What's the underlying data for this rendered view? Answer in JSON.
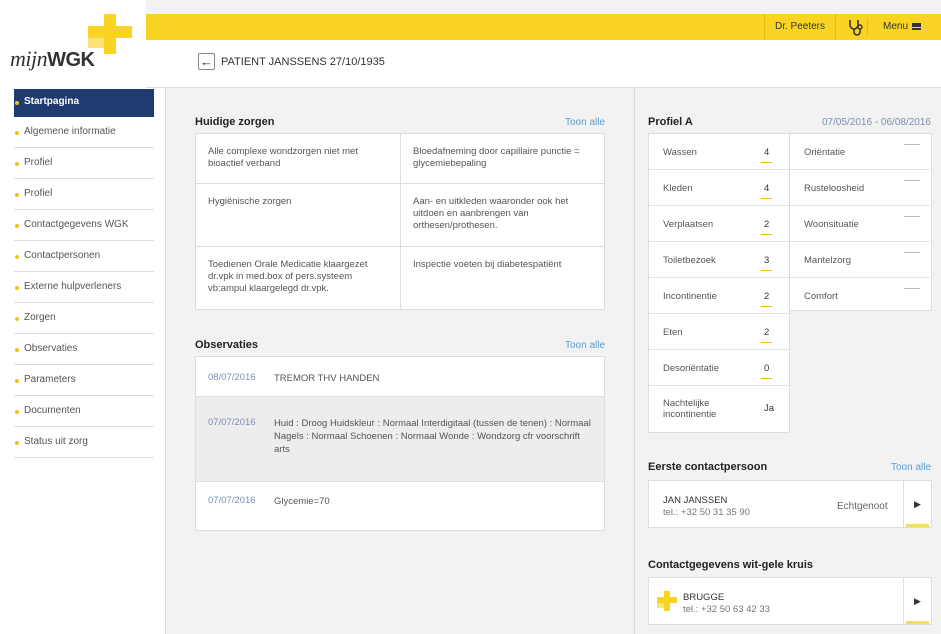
{
  "app": {
    "logo_prefix": "mijn",
    "logo_suffix": "WGK",
    "brand_color": "#f9d423",
    "nav_color": "#1f3b6f"
  },
  "topbar": {
    "doctor": "Dr. Peeters",
    "stethoscope_icon": "stethoscope-icon",
    "menu_label": "Menu",
    "menu_icon": "hamburger-icon"
  },
  "header": {
    "back_icon": "arrow-left-icon",
    "patient": "PATIENT JANSSENS 27/10/1935"
  },
  "sidebar": {
    "items": [
      {
        "label": "Startpagina",
        "active": true
      },
      {
        "label": "Algemene informatie"
      },
      {
        "label": "Profiel"
      },
      {
        "label": "Profiel"
      },
      {
        "label": "Contactgegevens WGK"
      },
      {
        "label": "Contactpersonen"
      },
      {
        "label": "Externe hulpverleners"
      },
      {
        "label": "Zorgen"
      },
      {
        "label": "Observaties"
      },
      {
        "label": "Parameters"
      },
      {
        "label": "Documenten"
      },
      {
        "label": "Status uit zorg"
      }
    ]
  },
  "zorgen": {
    "title": "Huidige zorgen",
    "toon": "Toon alle",
    "cells": [
      "Alle complexe wondzorgen niet met bioactief verband",
      "Bloedafneming door capillaire punctie = glycemiebepaling",
      "Hygiënische zorgen",
      "Aan- en uitkleden waaronder ook het uitdoen en aanbrengen van orthesen/prothesen.",
      "Toedienen Orale Medicatie klaargezet dr.vpk in med.box of pers.systeem vb:ampul klaargelegd dr.vpk.",
      "Inspectie voeten bij diabetespatiënt"
    ]
  },
  "observaties": {
    "title": "Observaties",
    "toon": "Toon alle",
    "rows": [
      {
        "date": "08/07/2016",
        "text": "TREMOR THV HANDEN"
      },
      {
        "date": "07/07/2016",
        "text": "Huid : Droog Huidskleur : Normaal Interdigitaal (tussen de tenen) : Normaal Nagels : Normaal Schoenen : Normaal Wonde : Wondzorg cfr voorschrift arts"
      },
      {
        "date": "07/07/2016",
        "text": "Glycemie=70"
      }
    ]
  },
  "profiel": {
    "title": "Profiel A",
    "period": "07/05/2016 - 06/08/2016",
    "left": [
      {
        "label": "Wassen",
        "value": "4"
      },
      {
        "label": "Kleden",
        "value": "4"
      },
      {
        "label": "Verplaatsen",
        "value": "2"
      },
      {
        "label": "Toiletbezoek",
        "value": "3"
      },
      {
        "label": "Incontinentie",
        "value": "2"
      },
      {
        "label": "Eten",
        "value": "2"
      },
      {
        "label": "Desoriëntatie",
        "value": "0"
      },
      {
        "label": "Nachtelijke incontinentie",
        "value": "Ja"
      }
    ],
    "right": [
      {
        "label": "Oriëntatie"
      },
      {
        "label": "Rusteloosheid"
      },
      {
        "label": "Woonsituatie"
      },
      {
        "label": "Mantelzorg"
      },
      {
        "label": "Comfort"
      }
    ]
  },
  "contact": {
    "title": "Eerste contactpersoon",
    "toon": "Toon alle",
    "name": "JAN JANSSEN",
    "tel": "tel.: +32 50 31 35 90",
    "relation": "Echtgenoot"
  },
  "wgk": {
    "title": "Contactgegevens wit-gele kruis",
    "city": "BRUGGE",
    "tel": "tel.: +32 50 63 42 33"
  }
}
